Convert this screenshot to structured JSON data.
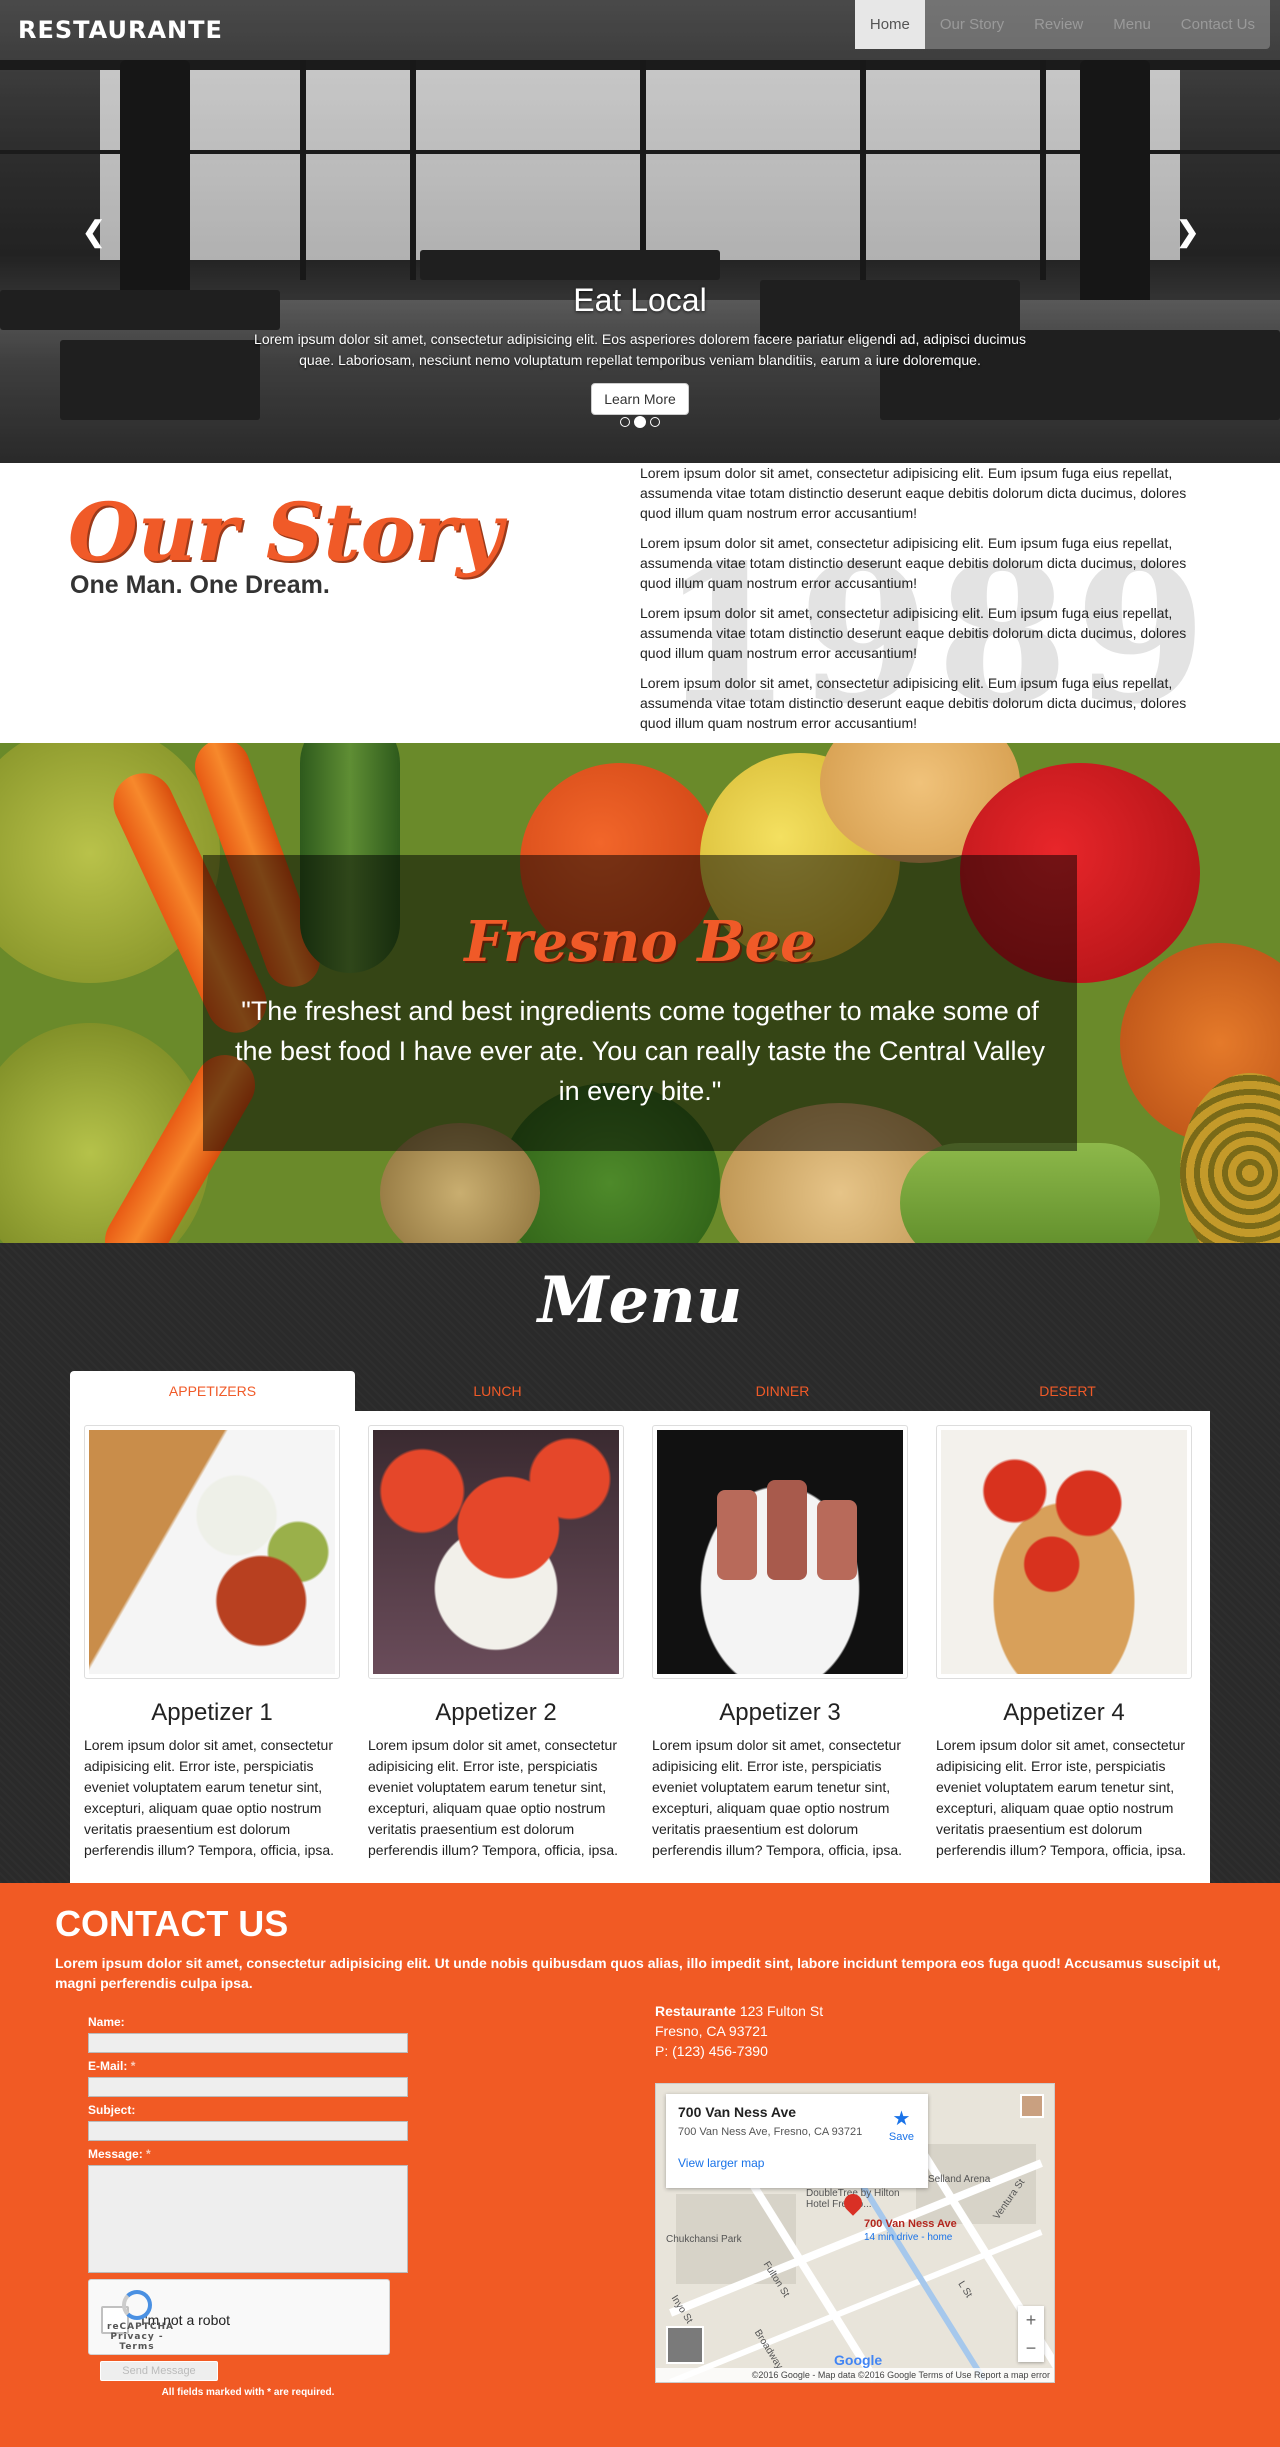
{
  "nav": {
    "logo": "RESTAURANTE",
    "items": [
      {
        "label": "Home",
        "active": true
      },
      {
        "label": "Our Story",
        "active": false
      },
      {
        "label": "Review",
        "active": false
      },
      {
        "label": "Menu",
        "active": false
      },
      {
        "label": "Contact Us",
        "active": false
      }
    ]
  },
  "hero": {
    "title": "Eat Local",
    "text": "Lorem ipsum dolor sit amet, consectetur adipisicing elit. Eos asperiores dolorem facere pariatur eligendi ad, adipisci ducimus quae. Laboriosam, nesciunt nemo voluptatum repellat temporibus veniam blanditiis, earum a iure doloremque.",
    "button": "Learn More",
    "prev_icon": "chevron-left-icon",
    "next_icon": "chevron-right-icon",
    "slides": 3,
    "active_slide": 2
  },
  "story": {
    "title": "Our Story",
    "subtitle": "One Man. One Dream.",
    "year": "1989",
    "paragraphs": [
      "Lorem ipsum dolor sit amet, consectetur adipisicing elit. Eum ipsum fuga eius repellat, assumenda vitae totam distinctio deserunt eaque debitis dolorum dicta ducimus, dolores quod illum quam nostrum error accusantium!",
      "Lorem ipsum dolor sit amet, consectetur adipisicing elit. Eum ipsum fuga eius repellat, assumenda vitae totam distinctio deserunt eaque debitis dolorum dicta ducimus, dolores quod illum quam nostrum error accusantium!",
      "Lorem ipsum dolor sit amet, consectetur adipisicing elit. Eum ipsum fuga eius repellat, assumenda vitae totam distinctio deserunt eaque debitis dolorum dicta ducimus, dolores quod illum quam nostrum error accusantium!",
      "Lorem ipsum dolor sit amet, consectetur adipisicing elit. Eum ipsum fuga eius repellat, assumenda vitae totam distinctio deserunt eaque debitis dolorum dicta ducimus, dolores quod illum quam nostrum error accusantium!"
    ]
  },
  "review": {
    "source": "Fresno Bee",
    "quote": "\"The freshest and best ingredients come together to make some of the best food I have ever ate. You can really taste the Central Valley in every bite.\""
  },
  "menu": {
    "title": "Menu",
    "tabs": [
      {
        "label": "Appetizers",
        "active": true
      },
      {
        "label": "Lunch",
        "active": false
      },
      {
        "label": "Dinner",
        "active": false
      },
      {
        "label": "Desert",
        "active": false
      }
    ],
    "items": [
      {
        "name": "Appetizer 1",
        "text": "Lorem ipsum dolor sit amet, consectetur adipisicing elit. Error iste, perspiciatis eveniet voluptatem earum tenetur sint, excepturi, aliquam quae optio nostrum veritatis praesentium est dolorum perferendis illum? Tempora, officia, ipsa."
      },
      {
        "name": "Appetizer 2",
        "text": "Lorem ipsum dolor sit amet, consectetur adipisicing elit. Error iste, perspiciatis eveniet voluptatem earum tenetur sint, excepturi, aliquam quae optio nostrum veritatis praesentium est dolorum perferendis illum? Tempora, officia, ipsa."
      },
      {
        "name": "Appetizer 3",
        "text": "Lorem ipsum dolor sit amet, consectetur adipisicing elit. Error iste, perspiciatis eveniet voluptatem earum tenetur sint, excepturi, aliquam quae optio nostrum veritatis praesentium est dolorum perferendis illum? Tempora, officia, ipsa."
      },
      {
        "name": "Appetizer 4",
        "text": "Lorem ipsum dolor sit amet, consectetur adipisicing elit. Error iste, perspiciatis eveniet voluptatem earum tenetur sint, excepturi, aliquam quae optio nostrum veritatis praesentium est dolorum perferendis illum? Tempora, officia, ipsa."
      }
    ]
  },
  "contact": {
    "title": "CONTACT US",
    "intro": "Lorem ipsum dolor sit amet, consectetur adipisicing elit. Ut unde nobis quibusdam quos alias, illo impedit sint, labore incidunt tempora eos fuga quod! Accusamus suscipit ut, magni perferendis culpa ipsa.",
    "fields": {
      "name_label": "Name:",
      "email_label": "E-Mail:",
      "subject_label": "Subject:",
      "message_label": "Message:",
      "required_mark": "*"
    },
    "captcha": {
      "label": "I'm not a robot",
      "brand": "reCAPTCHA",
      "links": "Privacy - Terms"
    },
    "submit": "Send Message",
    "footnote": "All fields marked with * are required.",
    "address": {
      "name": "Restaurante",
      "street": "123 Fulton St",
      "city": "Fresno, CA 93721",
      "phone": "P: (123) 456-7390"
    },
    "map": {
      "card_title": "700 Van Ness Ave",
      "card_address": "700 Van Ness Ave, Fresno, CA 93721",
      "card_link": "View larger map",
      "save_label": "Save",
      "pin_label": "700 Van Ness Ave",
      "pin_sub": "14 min drive - home",
      "labels": [
        "Chukchansi Park",
        "Fulton St",
        "Ventura St",
        "L St",
        "Inyo St",
        "Broadway",
        "Selland Arena",
        "DoubleTree by Hilton Hotel Fresno..."
      ],
      "attribution": "©2016 Google - Map data ©2016 Google   Terms of Use   Report a map error",
      "google": "Google"
    }
  }
}
